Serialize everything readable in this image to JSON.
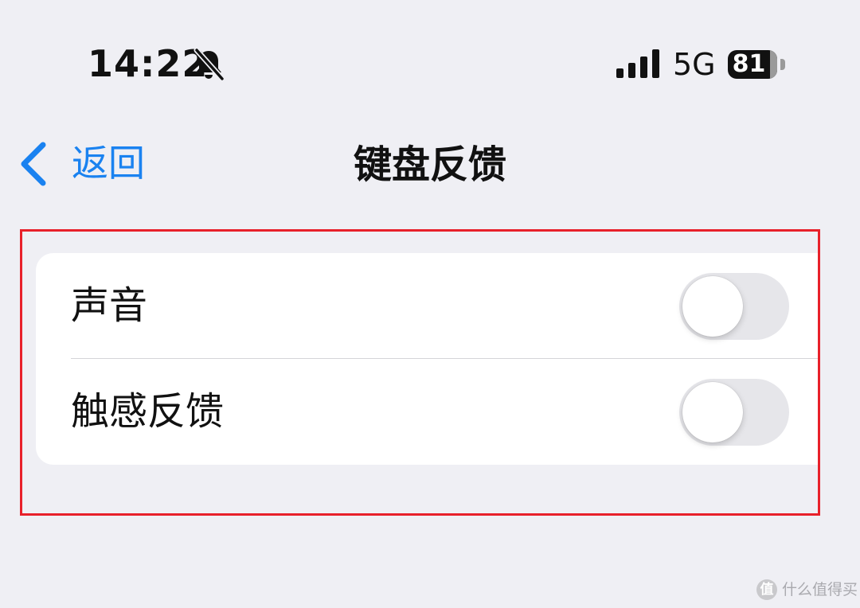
{
  "status_bar": {
    "time": "14:22",
    "network": "5G",
    "battery": "81",
    "icons": [
      "bell-slash-icon",
      "cellular-signal-icon",
      "battery-icon"
    ]
  },
  "nav": {
    "back_label": "返回",
    "title": "键盘反馈"
  },
  "settings": {
    "items": [
      {
        "label": "声音",
        "enabled": false
      },
      {
        "label": "触感反馈",
        "enabled": false
      }
    ]
  },
  "watermark": {
    "logo_glyph": "值",
    "text": "什么值得买"
  },
  "colors": {
    "background": "#efeff4",
    "accent": "#1a82f0",
    "highlight_border": "#e8202a",
    "toggle_off": "#e6e6ea",
    "card": "#ffffff"
  }
}
